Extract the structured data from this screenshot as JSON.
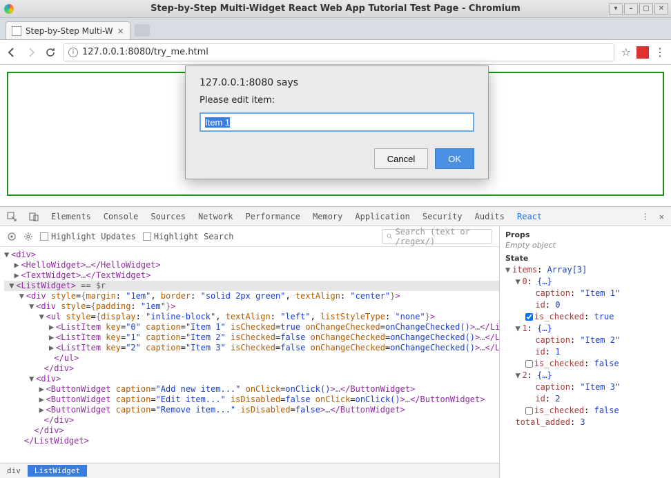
{
  "window": {
    "title": "Step-by-Step Multi-Widget React Web App Tutorial Test Page - Chromium"
  },
  "tabs": [
    {
      "title": "Step-by-Step Multi-W"
    }
  ],
  "address": {
    "url": "127.0.0.1:8080/try_me.html"
  },
  "dialog": {
    "title": "127.0.0.1:8080 says",
    "message": "Please edit item:",
    "input_value": "Item 1",
    "cancel_label": "Cancel",
    "ok_label": "OK"
  },
  "devtools": {
    "tabs": [
      "Elements",
      "Console",
      "Sources",
      "Network",
      "Performance",
      "Memory",
      "Application",
      "Security",
      "Audits",
      "React"
    ],
    "active_tab": "React",
    "toolbar": {
      "highlight_updates_label": "Highlight Updates",
      "highlight_search_label": "Highlight Search",
      "search_placeholder": "Search (text or /regex/)"
    },
    "dom": {
      "root_open": "<div>",
      "hello": {
        "open": "<HelloWidget>",
        "ellipsis": "…",
        "close": "</HelloWidget>"
      },
      "text": {
        "open": "<TextWidget>",
        "ellipsis": "…",
        "close": "</TextWidget>"
      },
      "list_widget_open": "<ListWidget>",
      "dollar_r": " == $r",
      "div_style1": {
        "margin": "1em",
        "border": "solid 2px green",
        "textAlign": "center"
      },
      "div_style2": {
        "padding": "1em"
      },
      "ul_style": {
        "display": "inline-block",
        "textAlign": "left",
        "listStyleType": "none"
      },
      "list_items": [
        {
          "key": "0",
          "caption": "Item 1",
          "isChecked": "true"
        },
        {
          "key": "1",
          "caption": "Item 2",
          "isChecked": "false"
        },
        {
          "key": "2",
          "caption": "Item 3",
          "isChecked": "false"
        }
      ],
      "on_change_checked": "onChangeChecked()",
      "list_item_close": "</ListItem>",
      "ul_close": "</ul>",
      "div_close": "</div>",
      "buttons": [
        {
          "caption": "Add new item...",
          "extra_attr": "onClick",
          "extra_val": "onClick()"
        },
        {
          "caption": "Edit item...",
          "extra_attr": "isDisabled",
          "extra_val": "false",
          "extra2_attr": "onClick",
          "extra2_val": "onClick()"
        },
        {
          "caption": "Remove item...",
          "extra_attr": "isDisabled",
          "extra_val": "false"
        }
      ],
      "button_close": "</ButtonWidget>",
      "list_widget_close": "</ListWidget>"
    },
    "crumbs": [
      "div",
      "ListWidget"
    ],
    "props": {
      "props_title": "Props",
      "props_empty": "Empty object",
      "state_title": "State",
      "items_label": "items",
      "items_type": "Array[3]",
      "items": [
        {
          "caption": "Item 1",
          "id": 0,
          "is_checked": true
        },
        {
          "caption": "Item 2",
          "id": 1,
          "is_checked": false
        },
        {
          "caption": "Item 3",
          "id": 2,
          "is_checked": false
        }
      ],
      "total_added_label": "total_added",
      "total_added": 3
    }
  }
}
